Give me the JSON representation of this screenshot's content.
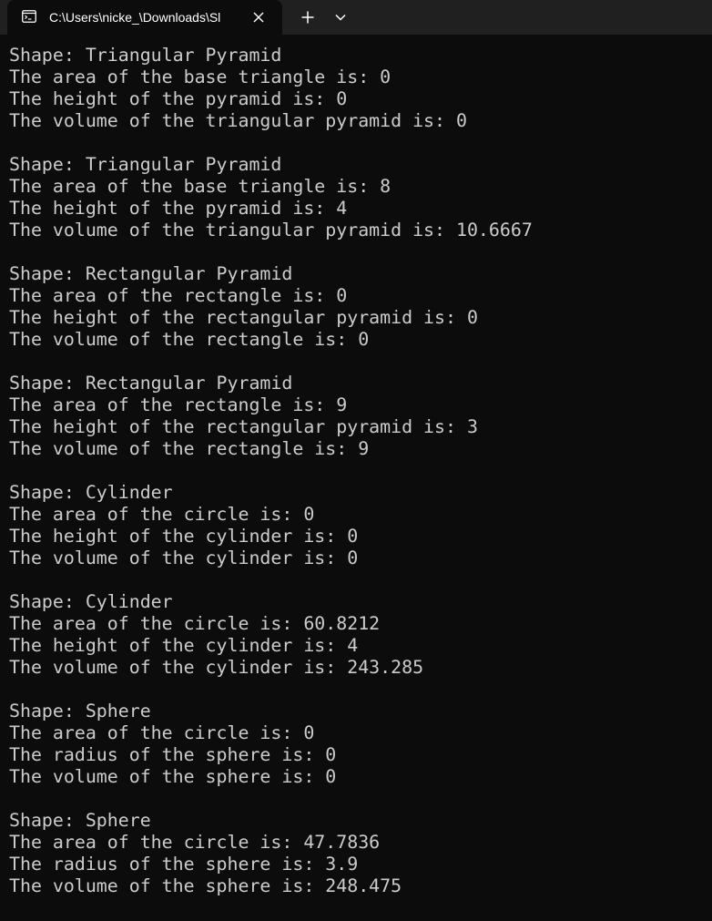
{
  "window": {
    "tab_title": "C:\\Users\\nicke_\\Downloads\\Sl",
    "tab_icon": "terminal-icon"
  },
  "colors": {
    "background": "#0c0c0c",
    "titlebar": "#202020",
    "text": "#cccccc"
  },
  "terminal": {
    "lines": [
      "Shape: Triangular Pyramid",
      "The area of the base triangle is: 0",
      "The height of the pyramid is: 0",
      "The volume of the triangular pyramid is: 0",
      "",
      "Shape: Triangular Pyramid",
      "The area of the base triangle is: 8",
      "The height of the pyramid is: 4",
      "The volume of the triangular pyramid is: 10.6667",
      "",
      "Shape: Rectangular Pyramid",
      "The area of the rectangle is: 0",
      "The height of the rectangular pyramid is: 0",
      "The volume of the rectangle is: 0",
      "",
      "Shape: Rectangular Pyramid",
      "The area of the rectangle is: 9",
      "The height of the rectangular pyramid is: 3",
      "The volume of the rectangle is: 9",
      "",
      "Shape: Cylinder",
      "The area of the circle is: 0",
      "The height of the cylinder is: 0",
      "The volume of the cylinder is: 0",
      "",
      "Shape: Cylinder",
      "The area of the circle is: 60.8212",
      "The height of the cylinder is: 4",
      "The volume of the cylinder is: 243.285",
      "",
      "Shape: Sphere",
      "The area of the circle is: 0",
      "The radius of the sphere is: 0",
      "The volume of the sphere is: 0",
      "",
      "Shape: Sphere",
      "The area of the circle is: 47.7836",
      "The radius of the sphere is: 3.9",
      "The volume of the sphere is: 248.475"
    ]
  }
}
